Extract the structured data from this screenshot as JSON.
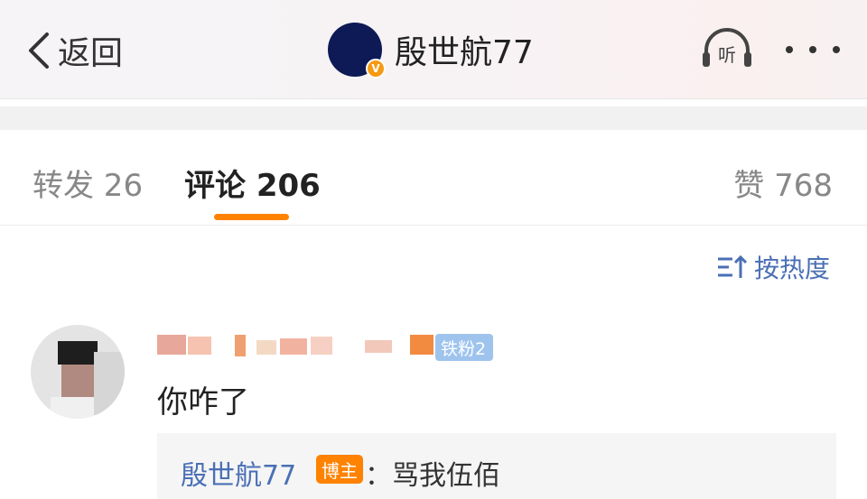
{
  "header": {
    "back_label": "返回",
    "title": "殷世航77",
    "badge": "V",
    "listen_label": "听"
  },
  "tabs": [
    {
      "label": "转发 26"
    },
    {
      "label": "评论 206"
    },
    {
      "label": "赞 768"
    }
  ],
  "sort": {
    "label": "按热度"
  },
  "comment": {
    "fan_badge": "铁粉2",
    "text": "你咋了",
    "reply": {
      "author": "殷世航77",
      "author_badge": "博主",
      "text": "：骂我伍佰"
    }
  },
  "colors": {
    "accent": "#ff8200",
    "link": "#4a6fb5",
    "avatar": "#0d1a55"
  }
}
